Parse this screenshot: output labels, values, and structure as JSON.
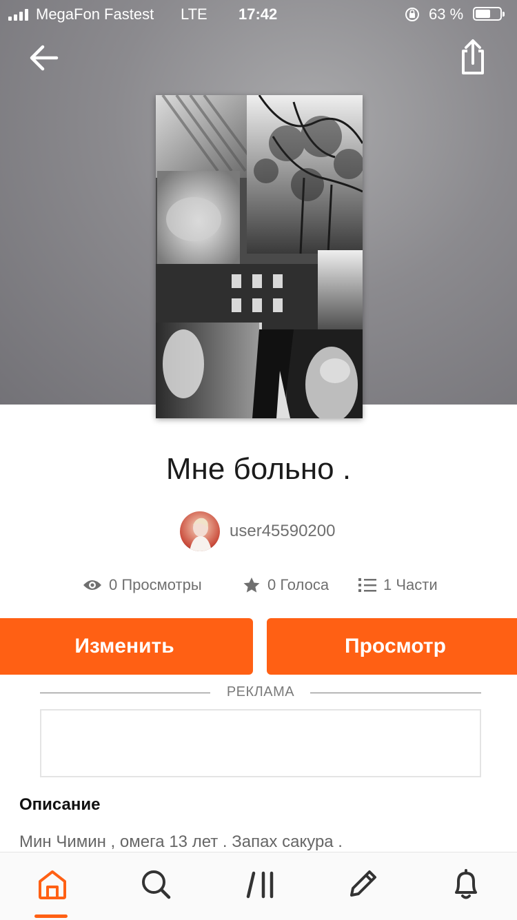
{
  "status_bar": {
    "carrier": "MegaFon Fastest",
    "network": "LTE",
    "time": "17:42",
    "battery_percent": "63 %",
    "battery_level": 0.63
  },
  "story": {
    "title": "Мне больно .",
    "author": "user45590200",
    "stats": {
      "views": "0 Просмотры",
      "votes": "0 Голоса",
      "parts": "1 Части"
    },
    "description_heading": "Описание",
    "description_text": "Мин Чимин , омега 13 лет  . Запах сакура ."
  },
  "actions": {
    "edit_label": "Изменить",
    "view_label": "Просмотр"
  },
  "ad": {
    "label": "РЕКЛАМА"
  },
  "tabbar": {
    "items": [
      "home-icon",
      "search-icon",
      "library-icon",
      "write-icon",
      "notifications-icon"
    ],
    "active": "home-icon"
  },
  "colors": {
    "accent": "#ff6014",
    "hero_background": "#8b8a8e"
  }
}
